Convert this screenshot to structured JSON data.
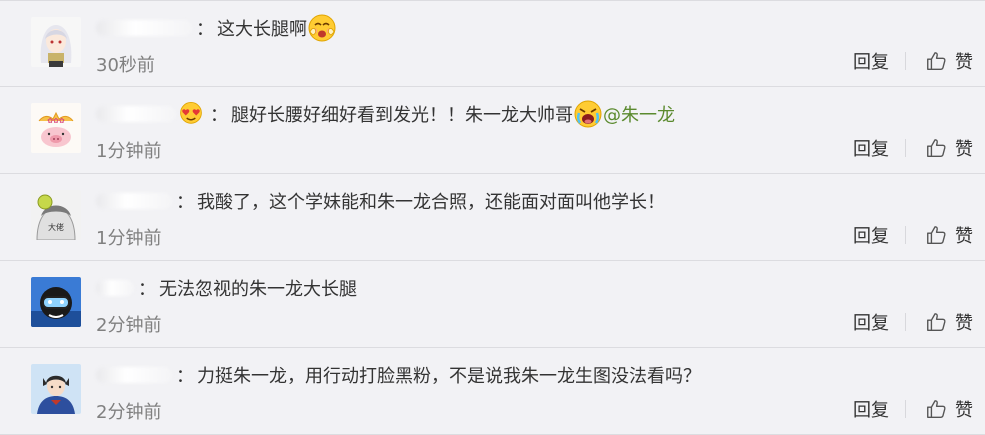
{
  "colors": {
    "background": "#f2f2f5",
    "divider": "#dcdce0",
    "timestamp": "#808080",
    "mention": "#5b8a2e"
  },
  "comments": [
    {
      "username": "",
      "separator": "：",
      "parts": [
        {
          "type": "text",
          "value": "这大长腿啊"
        },
        {
          "type": "emoji",
          "name": "shy-face-emoji"
        }
      ],
      "time": "30秒前",
      "reply_label": "回复",
      "like_label": "赞",
      "avatar_icon": "anime-girl-avatar"
    },
    {
      "username": "",
      "separator": "：",
      "badge": "heart-face-emoji",
      "parts": [
        {
          "type": "text",
          "value": "腿好长腰好细好看到发光！！朱一龙大帅哥"
        },
        {
          "type": "emoji",
          "name": "crying-face-emoji"
        },
        {
          "type": "mention",
          "value": "@朱一龙"
        }
      ],
      "time": "1分钟前",
      "reply_label": "回复",
      "like_label": "赞",
      "avatar_icon": "pink-pig-avatar"
    },
    {
      "username": "",
      "separator": "：",
      "parts": [
        {
          "type": "text",
          "value": "我酸了，这个学妹能和朱一龙合照，还能面对面叫他学长！"
        }
      ],
      "time": "1分钟前",
      "reply_label": "回复",
      "like_label": "赞",
      "avatar_icon": "sketch-character-avatar"
    },
    {
      "username": "",
      "separator": "：",
      "parts": [
        {
          "type": "text",
          "value": "无法忽视的朱一龙大长腿"
        }
      ],
      "time": "2分钟前",
      "reply_label": "回复",
      "like_label": "赞",
      "avatar_icon": "blue-diver-avatar"
    },
    {
      "username": "",
      "separator": "：",
      "parts": [
        {
          "type": "text",
          "value": "力挺朱一龙，用行动打脸黑粉，不是说我朱一龙生图没法看吗？"
        }
      ],
      "time": "2分钟前",
      "reply_label": "回复",
      "like_label": "赞",
      "avatar_icon": "girl-photo-avatar"
    }
  ]
}
